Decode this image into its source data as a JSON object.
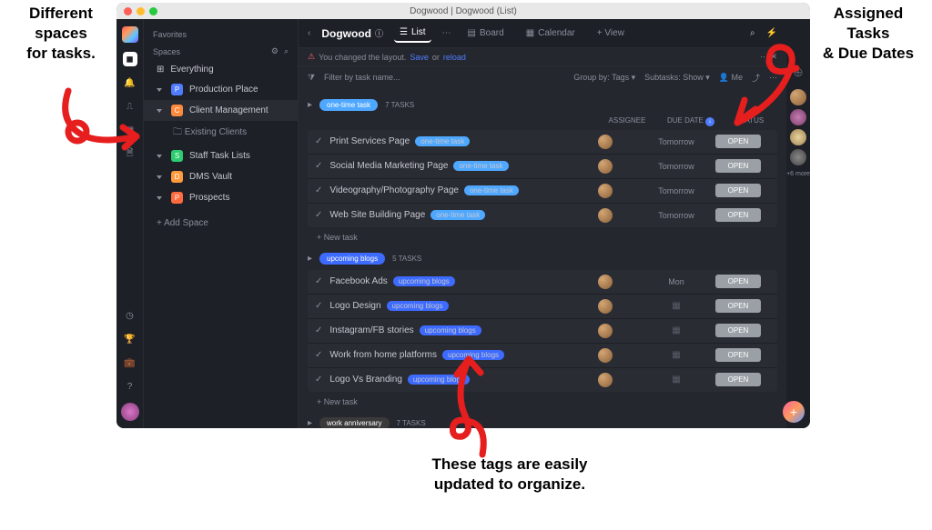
{
  "annotations": {
    "top_left": "Different\nspaces\nfor tasks.",
    "top_right": "Assigned\nTasks\n& Due Dates",
    "bottom": "These tags are easily\nupdated to organize."
  },
  "titlebar": {
    "title": "Dogwood | Dogwood (List)"
  },
  "sidebar": {
    "favorites": "Favorites",
    "spaces": "Spaces",
    "everything": "Everything",
    "items": [
      {
        "label": "Production Place",
        "color": "#4f7cff"
      },
      {
        "label": "Client Management",
        "color": "#ff8a3d",
        "sel": true
      },
      {
        "label": "Staff Task Lists",
        "color": "#2ecc71"
      },
      {
        "label": "DMS Vault",
        "color": "#ff9a3d"
      },
      {
        "label": "Prospects",
        "color": "#ff6b3d"
      }
    ],
    "sub": "Existing Clients",
    "add": "+  Add Space"
  },
  "topbar": {
    "crumb": "Dogwood",
    "views": [
      "List",
      "Board",
      "Calendar"
    ],
    "add_view": "+ View"
  },
  "notice": {
    "prefix": "You changed the layout.",
    "save": "Save",
    "or": "or",
    "reload": "reload"
  },
  "toolbar": {
    "filter": "Filter by task name...",
    "group_by": "Group by: Tags",
    "subtasks": "Subtasks: Show",
    "me": "Me"
  },
  "columns": {
    "assignee": "ASSIGNEE",
    "due": "DUE DATE",
    "status": "STATUS"
  },
  "groups": [
    {
      "tag": "one-time task",
      "tag_color": "#4fa8ff",
      "count": "7 TASKS",
      "tasks": [
        {
          "name": "Print Services Page",
          "due": "Tomorrow"
        },
        {
          "name": "Social Media Marketing Page",
          "due": "Tomorrow"
        },
        {
          "name": "Videography/Photography Page",
          "due": "Tomorrow"
        },
        {
          "name": "Web Site Building Page",
          "due": "Tomorrow"
        }
      ]
    },
    {
      "tag": "upcoming blogs",
      "tag_color": "#3d6bff",
      "count": "5 TASKS",
      "tasks": [
        {
          "name": "Facebook Ads",
          "due": "Mon"
        },
        {
          "name": "Logo Design",
          "due": ""
        },
        {
          "name": "Instagram/FB stories",
          "due": ""
        },
        {
          "name": "Work from home platforms",
          "due": ""
        },
        {
          "name": "Logo Vs Branding",
          "due": ""
        }
      ]
    },
    {
      "tag": "work anniversary",
      "tag_color": "#3a3a3a",
      "count": "7 TASKS",
      "tasks": []
    }
  ],
  "status_label": "OPEN",
  "new_task": "+ New task",
  "presence_more": "+6\nmore"
}
